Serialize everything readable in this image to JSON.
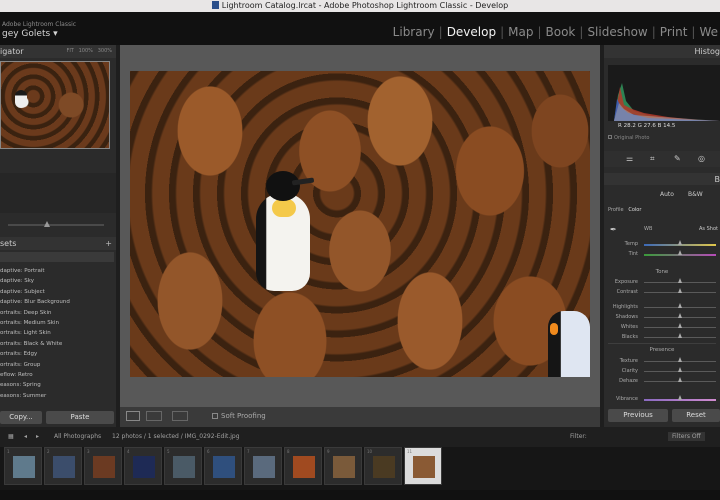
{
  "window": {
    "title": "Lightroom Catalog.lrcat - Adobe Photoshop Lightroom Classic - Develop"
  },
  "identity": {
    "catalog": "Adobe Lightroom Classic",
    "user": "gey Golets",
    "user_caret": "▾"
  },
  "modules": [
    "Library",
    "Develop",
    "Map",
    "Book",
    "Slideshow",
    "Print",
    "We"
  ],
  "active_module": "Develop",
  "navigator": {
    "title": "igator",
    "zoom_options": [
      "FIT",
      "100%",
      "300%"
    ]
  },
  "presets": {
    "title": "sets",
    "add": "+",
    "items": [
      "daptive: Portrait",
      "daptive: Sky",
      "daptive: Subject",
      "daptive: Blur Background",
      "ortraits: Deep Skin",
      "ortraits: Medium Skin",
      "ortraits: Light Skin",
      "ortraits: Black & White",
      "ortraits: Edgy",
      "ortraits: Group",
      "eflow: Retro",
      "easons: Spring",
      "easons: Summer"
    ]
  },
  "left_buttons": {
    "copy": "Copy...",
    "paste": "Paste"
  },
  "toolbar": {
    "soft_proofing": "Soft Proofing"
  },
  "histogram": {
    "title": "Histog",
    "values": "R  28.2  G  27.6  B  14.5",
    "original_photo": "Original Photo"
  },
  "basic": {
    "treatment": [
      "Auto",
      "B&W"
    ],
    "profile_label": "Profile",
    "profile_value": "Color",
    "wb_label": "WB",
    "wb_value": "As Shot",
    "tone_label": "Tone",
    "presence_label": "Presence",
    "sliders": [
      {
        "label": "Temp",
        "value": 0.5,
        "kind": "temp"
      },
      {
        "label": "Tint",
        "value": 0.5,
        "kind": "tint"
      },
      {
        "label": "Exposure",
        "value": 0.5,
        "kind": "plain"
      },
      {
        "label": "Contrast",
        "value": 0.5,
        "kind": "plain"
      },
      {
        "label": "Highlights",
        "value": 0.5,
        "kind": "plain"
      },
      {
        "label": "Shadows",
        "value": 0.5,
        "kind": "plain"
      },
      {
        "label": "Whites",
        "value": 0.5,
        "kind": "plain"
      },
      {
        "label": "Blacks",
        "value": 0.5,
        "kind": "plain"
      },
      {
        "label": "Texture",
        "value": 0.5,
        "kind": "plain"
      },
      {
        "label": "Clarity",
        "value": 0.5,
        "kind": "plain"
      },
      {
        "label": "Dehaze",
        "value": 0.5,
        "kind": "plain"
      },
      {
        "label": "Vibrance",
        "value": 0.5,
        "kind": "vib"
      }
    ]
  },
  "right_buttons": {
    "previous": "Previous",
    "reset": "Reset"
  },
  "filmstrip_bar": {
    "source": "All Photographs",
    "info": "12 photos / 1 selected / IMG_0292-Edit.jpg",
    "filter_label": "Filter:",
    "filter_value": "Filters Off"
  },
  "filmstrip": [
    {
      "n": "1",
      "color": "#5f7a8c"
    },
    {
      "n": "2",
      "color": "#3b4d6b"
    },
    {
      "n": "3",
      "color": "#6b3a22"
    },
    {
      "n": "4",
      "color": "#1e2a55"
    },
    {
      "n": "5",
      "color": "#4a5a66"
    },
    {
      "n": "6",
      "color": "#2f4f7d"
    },
    {
      "n": "7",
      "color": "#5a6a7d"
    },
    {
      "n": "8",
      "color": "#a04a20"
    },
    {
      "n": "9",
      "color": "#7a5a3a"
    },
    {
      "n": "10",
      "color": "#4a3a22"
    },
    {
      "n": "11",
      "color": "#8a5a34",
      "selected": true
    }
  ]
}
